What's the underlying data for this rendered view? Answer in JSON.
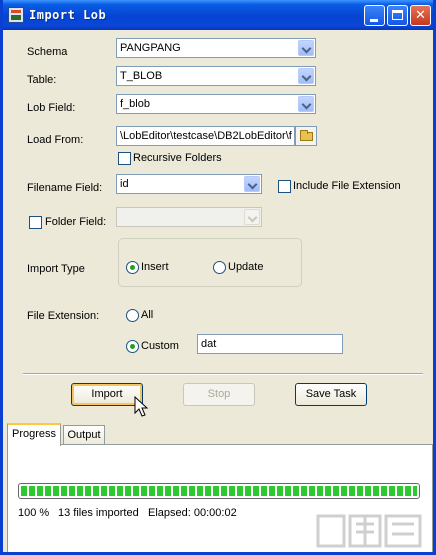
{
  "window": {
    "title": "Import Lob"
  },
  "form": {
    "schema": {
      "label": "Schema",
      "value": "PANGPANG"
    },
    "table": {
      "label": "Table:",
      "value": "T_BLOB"
    },
    "lob_field": {
      "label": "Lob Field:",
      "value": "f_blob"
    },
    "load_from": {
      "label": "Load From:",
      "value": "\\LobEditor\\testcase\\DB2LobEditor\\f"
    },
    "recursive": {
      "label": "Recursive Folders",
      "checked": false
    },
    "filename_field": {
      "label": "Filename Field:",
      "value": "id"
    },
    "include_ext": {
      "label": "Include File Extension",
      "checked": false
    },
    "folder_field": {
      "label": "Folder Field:",
      "checked": false,
      "value": ""
    },
    "import_type": {
      "label": "Import Type",
      "options": [
        "Insert",
        "Update"
      ],
      "selected": "Insert"
    },
    "file_extension": {
      "label": "File Extension:",
      "options": [
        "All",
        "Custom"
      ],
      "selected": "Custom",
      "custom_value": "dat"
    }
  },
  "buttons": {
    "import": "Import",
    "stop": "Stop",
    "save_task": "Save Task"
  },
  "tabs": [
    {
      "label": "Progress",
      "active": true
    },
    {
      "label": "Output",
      "active": false
    }
  ],
  "progress": {
    "fraction": 1.0,
    "percent_text": "100 %",
    "files_text": "13 files imported",
    "elapsed_text": "Elapsed: 00:00:02",
    "bar_color": "#2bcb30"
  },
  "colors": {
    "titlebar": "#0a5de3",
    "window_bg": "#ece9d8"
  }
}
